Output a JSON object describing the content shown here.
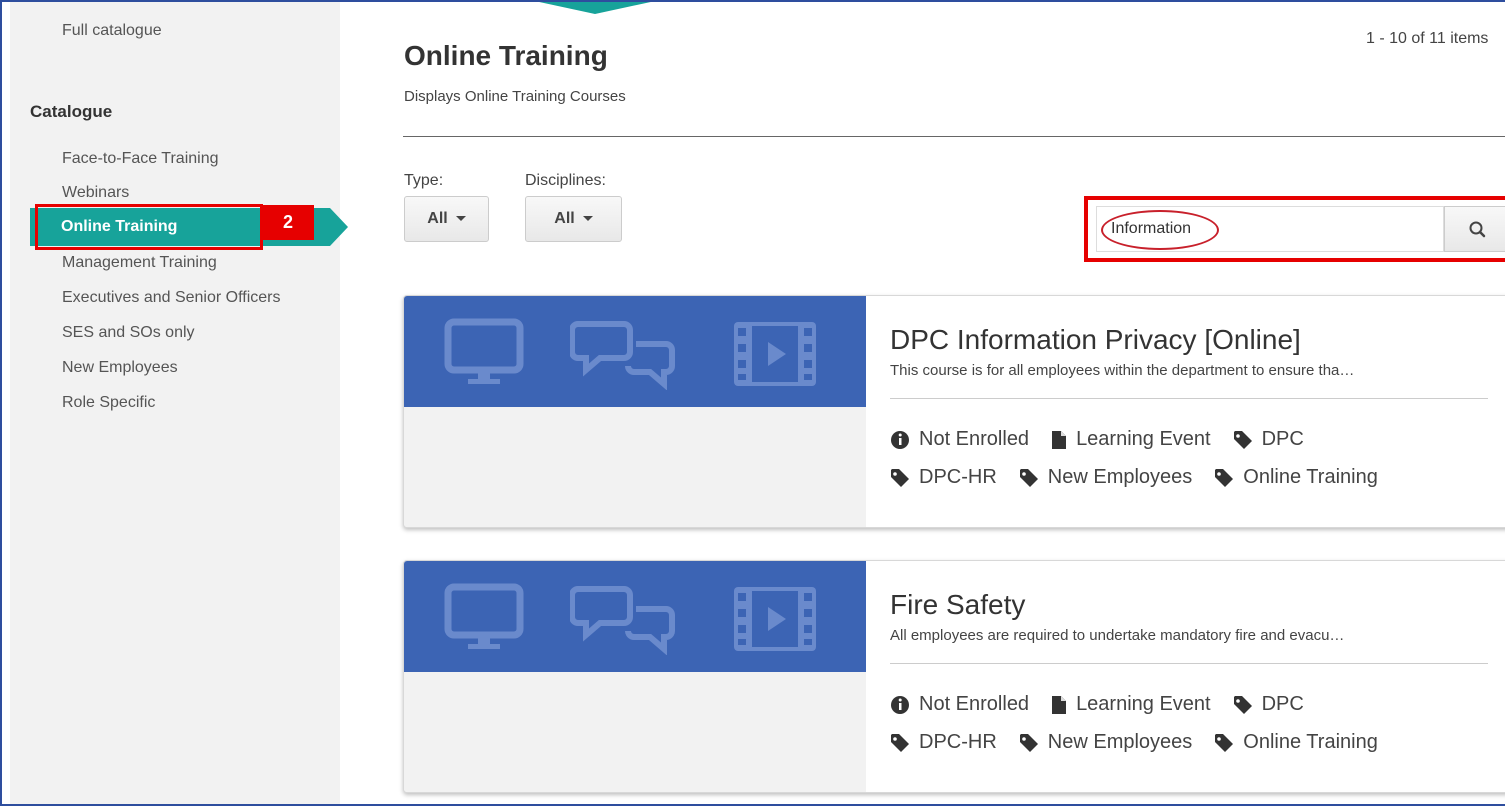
{
  "sidebar": {
    "full_catalogue": "Full catalogue",
    "catalogue_heading": "Catalogue",
    "items": [
      {
        "label": "Face-to-Face Training"
      },
      {
        "label": "Webinars"
      },
      {
        "label": "Online Training"
      },
      {
        "label": "Management Training"
      },
      {
        "label": "Executives and Senior Officers"
      },
      {
        "label": "SES and SOs only"
      },
      {
        "label": "New Employees"
      },
      {
        "label": "Role Specific"
      }
    ],
    "step_badge": "2"
  },
  "main": {
    "title": "Online Training",
    "subtitle": "Displays Online Training Courses",
    "item_count": "1 - 10 of 11 items"
  },
  "filters": {
    "type_label": "Type:",
    "type_value": "All",
    "disciplines_label": "Disciplines:",
    "disciplines_value": "All"
  },
  "search": {
    "value": "Information"
  },
  "courses": [
    {
      "title": "DPC Information Privacy [Online]",
      "description": "This course is for all employees within the department to ensure tha…",
      "status": "Not Enrolled",
      "event_type": "Learning Event",
      "tags_row1": [
        "DPC"
      ],
      "tags_row2": [
        "DPC-HR",
        "New Employees",
        "Online Training"
      ]
    },
    {
      "title": "Fire Safety",
      "description": "All employees are required to undertake mandatory fire and evacu…",
      "status": "Not Enrolled",
      "event_type": "Learning Event",
      "tags_row1": [
        "DPC"
      ],
      "tags_row2": [
        "DPC-HR",
        "New Employees",
        "Online Training"
      ]
    }
  ],
  "colors": {
    "accent": "#17a39a",
    "banner": "#3c64b4",
    "highlight": "#e60000"
  }
}
